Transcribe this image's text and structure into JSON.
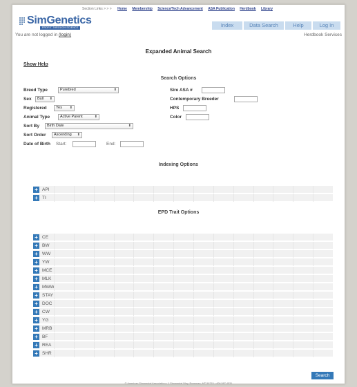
{
  "top_links": {
    "label": "Section Links > > >",
    "items": [
      "Home",
      "Membership",
      "Science/Tech Advancement",
      "ASA Publication",
      "Herdbook",
      "Library"
    ]
  },
  "brand": {
    "name": "SimGenetics",
    "tagline": "PROFIT THROUGH SCIENCE",
    "accent": "#3a66a6"
  },
  "nav_tabs": [
    "Index",
    "Data Search",
    "Help",
    "Log In"
  ],
  "login_status": {
    "text": "You are not logged in",
    "link": "(login)"
  },
  "herdbook_services": "Herdbook Services",
  "page_title": "Expanded Animal Search",
  "show_help": "Show Help",
  "search_options": {
    "heading": "Search Options",
    "breed_type": {
      "label": "Breed Type",
      "value": "Purebred"
    },
    "sex": {
      "label": "Sex",
      "value": "Bull"
    },
    "registered": {
      "label": "Registered",
      "value": "Yes"
    },
    "animal_type": {
      "label": "Animal Type",
      "value": "Active Parent"
    },
    "sort_by": {
      "label": "Sort By",
      "value": "Birth Date"
    },
    "sort_order": {
      "label": "Sort Order",
      "value": "Ascending"
    },
    "dob": {
      "label": "Date of Birth",
      "start": "Start:",
      "end": "End:"
    },
    "sire_asa": {
      "label": "Sire ASA #"
    },
    "contemporary_breeder": {
      "label": "Contemporary Breeder"
    },
    "hps": {
      "label": "HPS"
    },
    "color": {
      "label": "Color"
    }
  },
  "indexing_options": {
    "heading": "Indexing Options",
    "items": [
      "API",
      "TI"
    ]
  },
  "epd_trait_options": {
    "heading": "EPD Trait Options",
    "items": [
      "CE",
      "BW",
      "WW",
      "YW",
      "MCE",
      "MLK",
      "MWW",
      "STAY",
      "DOC",
      "CW",
      "YG",
      "MRB",
      "BF",
      "REA",
      "SHR"
    ]
  },
  "search_button": "Search",
  "footer": "© American Simmental Association • 1 Simmental Way, Bozeman, MT 59715 • 406.587.4531",
  "colors": {
    "tab_bg": "#c9dcef",
    "tab_text": "#5a86b9",
    "expand_button": "#3479b8",
    "row_bg": "#f1f1f1"
  }
}
